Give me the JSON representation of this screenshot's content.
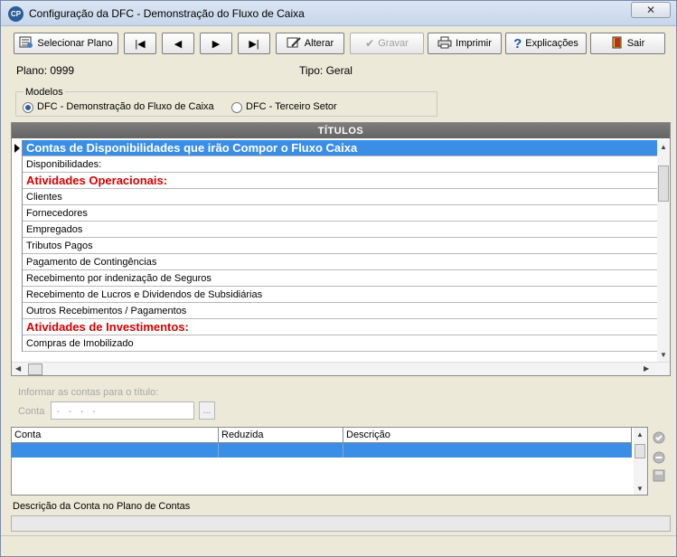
{
  "window": {
    "title": "Configuração da DFC - Demonstração do Fluxo de Caixa",
    "app_icon": "CP",
    "close_glyph": "✕"
  },
  "toolbar": {
    "select_plan": "Selecionar Plano",
    "first": "|◀",
    "prev": "◀",
    "next": "▶",
    "last": "▶|",
    "edit": "Alterar",
    "save": "Gravar",
    "print": "Imprimir",
    "help": "Explicações",
    "exit": "Sair"
  },
  "info": {
    "plano": "Plano: 0999",
    "tipo": "Tipo:  Geral"
  },
  "models": {
    "label": "Modelos",
    "options": [
      {
        "label": "DFC - Demonstração do Fluxo de Caixa",
        "checked": true
      },
      {
        "label": "DFC - Terceiro Setor",
        "checked": false
      }
    ]
  },
  "titles_grid": {
    "header": "TÍTULOS",
    "rows": [
      {
        "text": "Contas de Disponibilidades que irão Compor o Fluxo Caixa",
        "kind": "selected"
      },
      {
        "text": "Disponibilidades:",
        "kind": "normal"
      },
      {
        "text": "Atividades Operacionais:",
        "kind": "section"
      },
      {
        "text": "Clientes",
        "kind": "normal"
      },
      {
        "text": "Fornecedores",
        "kind": "normal"
      },
      {
        "text": "Empregados",
        "kind": "normal"
      },
      {
        "text": "Tributos Pagos",
        "kind": "normal"
      },
      {
        "text": "Pagamento de Contingências",
        "kind": "normal"
      },
      {
        "text": "Recebimento por indenização de Seguros",
        "kind": "normal"
      },
      {
        "text": "Recebimento de Lucros e Dividendos de Subsidiárias",
        "kind": "normal"
      },
      {
        "text": "Outros Recebimentos / Pagamentos",
        "kind": "normal"
      },
      {
        "text": "Atividades de Investimentos:",
        "kind": "section"
      },
      {
        "text": "Compras de Imobilizado",
        "kind": "normal"
      }
    ]
  },
  "accounts_form": {
    "info_label": "Informar as contas para o título:",
    "conta_label": "Conta",
    "conta_value": ". . . .",
    "dots_button": "..."
  },
  "accounts_table": {
    "columns": [
      "Conta",
      "Reduzida",
      "Descrição"
    ]
  },
  "description_label": "Descrição da Conta no Plano de Contas",
  "colors": {
    "selection": "#3a8ee6",
    "section_text": "#d40000",
    "grid_header": "#6e6e6e"
  }
}
